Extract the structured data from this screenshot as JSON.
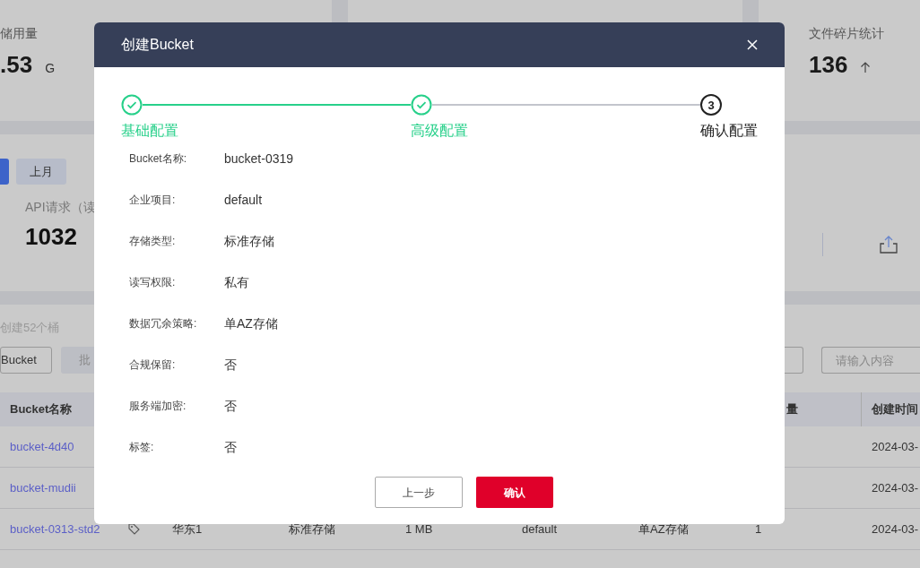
{
  "background": {
    "storage_card": {
      "label": "储用量",
      "value": ".53",
      "unit": "G"
    },
    "fragment_card": {
      "label": "文件碎片统计",
      "value": "136"
    },
    "period": {
      "month_label": "上月"
    },
    "api_card": {
      "label": "API请求（读",
      "value": "1032"
    },
    "bucket_count": "创建52个桶",
    "toolbar": {
      "create_label": "Bucket",
      "batch_label": "批",
      "search_placeholder": "请输入内容"
    },
    "table": {
      "columns": {
        "name": "Bucket名称",
        "count": "量",
        "created": "创建时间"
      },
      "rows": [
        {
          "name": "bucket-4d40",
          "created": "2024-03-"
        },
        {
          "name": "bucket-mudii",
          "created": "2024-03-"
        },
        {
          "name": "bucket-0313-std2",
          "region": "华东1",
          "storage_class": "标准存储",
          "size": "1 MB",
          "project": "default",
          "redundancy": "单AZ存储",
          "count": "1",
          "created": "2024-03-"
        }
      ]
    }
  },
  "dialog": {
    "title": "创建Bucket",
    "steps": [
      {
        "label": "基础配置",
        "done": true
      },
      {
        "label": "高级配置",
        "done": true
      },
      {
        "label": "确认配置",
        "done": false,
        "number": "3"
      }
    ],
    "details": [
      {
        "label": "Bucket名称:",
        "value": "bucket-0319"
      },
      {
        "label": "企业项目:",
        "value": "default"
      },
      {
        "label": "存储类型:",
        "value": "标准存储"
      },
      {
        "label": "读写权限:",
        "value": "私有"
      },
      {
        "label": "数据冗余策略:",
        "value": "单AZ存储"
      },
      {
        "label": "合规保留:",
        "value": "否"
      },
      {
        "label": "服务端加密:",
        "value": "否"
      },
      {
        "label": "标签:",
        "value": "否"
      }
    ],
    "buttons": [
      {
        "label": "上一步",
        "kind": "secondary"
      },
      {
        "label": "确认",
        "kind": "primary"
      }
    ]
  }
}
